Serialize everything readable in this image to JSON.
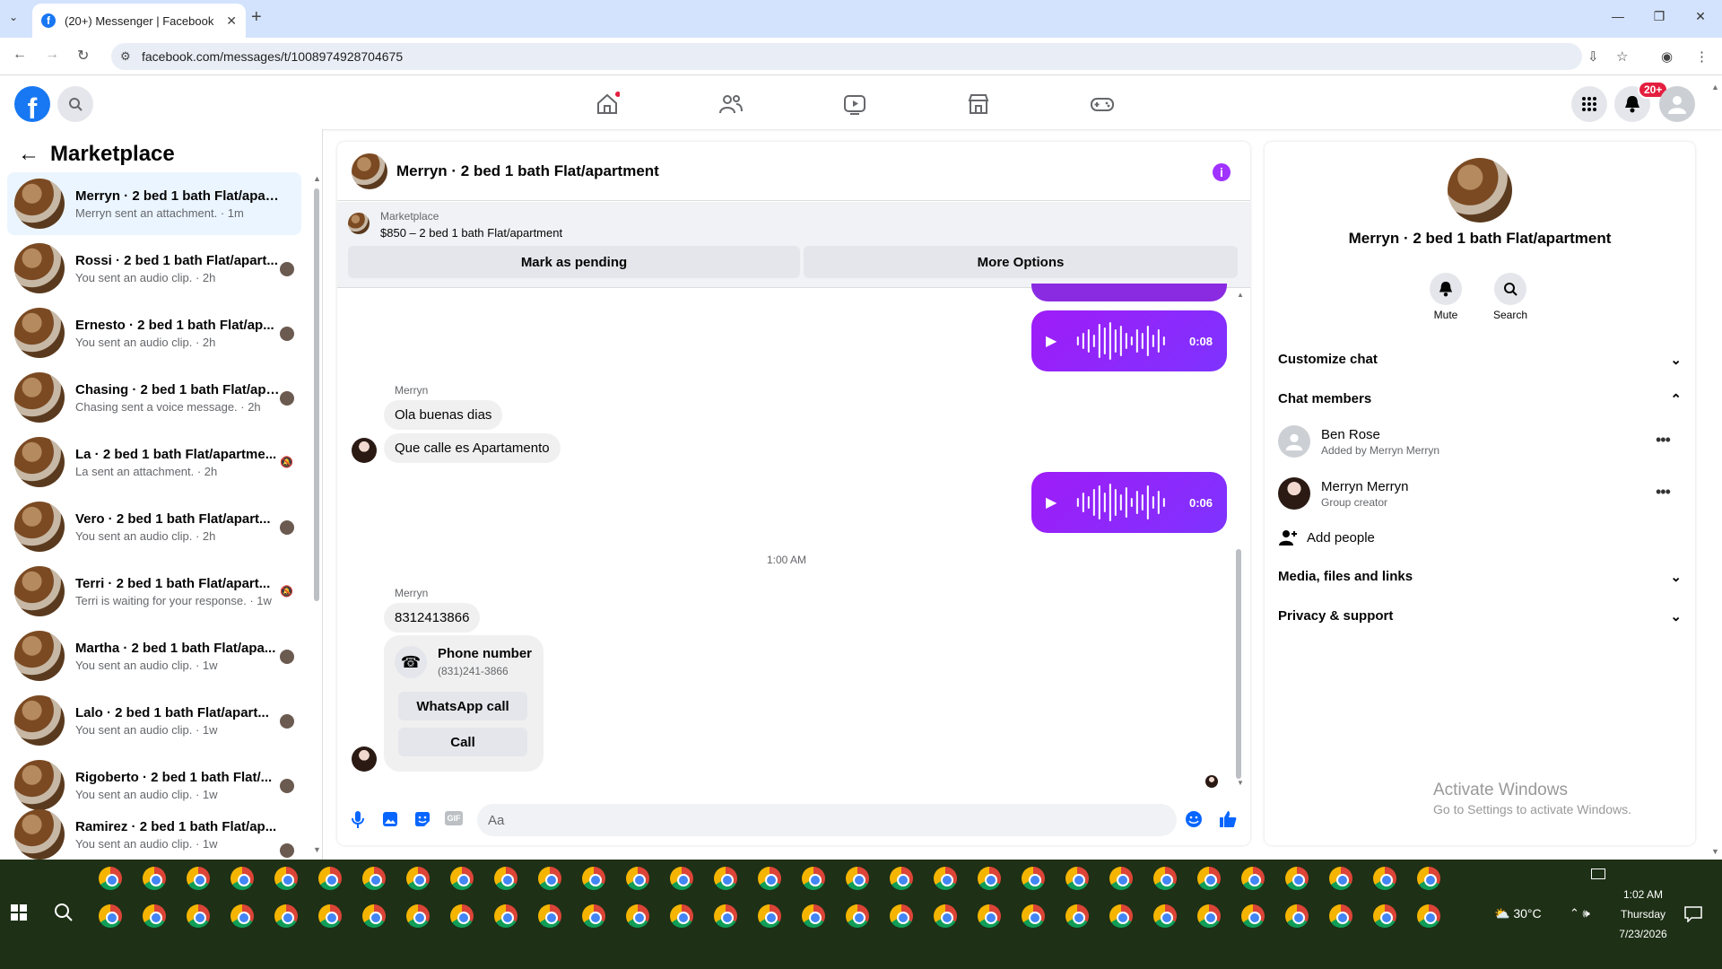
{
  "browser": {
    "tab_title": "(20+) Messenger | Facebook",
    "url": "facebook.com/messages/t/1008974928704675"
  },
  "header": {
    "notification_badge": "20+"
  },
  "sidebar": {
    "title": "Marketplace",
    "conversations": [
      {
        "name": "Merryn · 2 bed 1 bath Flat/apart...",
        "sub": "Merryn sent an attachment. · 1m",
        "active": true
      },
      {
        "name": "Rossi · 2 bed 1 bath Flat/apart...",
        "sub": "You sent an audio clip. · 2h"
      },
      {
        "name": "Ernesto · 2 bed 1 bath Flat/ap...",
        "sub": "You sent an audio clip. · 2h"
      },
      {
        "name": "Chasing · 2 bed 1 bath Flat/apart...",
        "sub": "Chasing sent a voice message. · 2h"
      },
      {
        "name": "La · 2 bed 1 bath Flat/apartme...",
        "sub": "La sent an attachment. · 2h"
      },
      {
        "name": "Vero · 2 bed 1 bath Flat/apart...",
        "sub": "You sent an audio clip. · 2h"
      },
      {
        "name": "Terri · 2 bed 1 bath Flat/apart...",
        "sub": "Terri is waiting for your response. · 1w"
      },
      {
        "name": "Martha · 2 bed 1 bath Flat/apa...",
        "sub": "You sent an audio clip. · 1w"
      },
      {
        "name": "Lalo · 2 bed 1 bath Flat/apart...",
        "sub": "You sent an audio clip. · 1w"
      },
      {
        "name": "Rigoberto · 2 bed 1 bath Flat/...",
        "sub": "You sent an audio clip. · 1w"
      },
      {
        "name": "Ramirez · 2 bed 1 bath Flat/ap...",
        "sub": "You sent an audio clip. · 1w"
      }
    ]
  },
  "chat": {
    "title": "Merryn · 2 bed 1 bath Flat/apartment",
    "marketplace_label": "Marketplace",
    "listing": "$850 – 2 bed 1 bath Flat/apartment",
    "mark_pending": "Mark as pending",
    "more_options": "More Options",
    "audio1_duration": "0:08",
    "audio2_duration": "0:06",
    "sender_name": "Merryn",
    "msg1": "Ola buenas  dias",
    "msg2": "Que calle es Apartamento",
    "timestamp": "1:00 AM",
    "msg3": "8312413866",
    "phone_card_title": "Phone number",
    "phone_card_number": "(831)241-3866",
    "whatsapp_call": "WhatsApp call",
    "call": "Call",
    "composer_placeholder": "Aa"
  },
  "details": {
    "title": "Merryn · 2 bed 1 bath Flat/apartment",
    "mute": "Mute",
    "search": "Search",
    "customize_chat": "Customize chat",
    "chat_members": "Chat members",
    "members": [
      {
        "name": "Ben Rose",
        "sub": "Added by Merryn Merryn"
      },
      {
        "name": "Merryn Merryn",
        "sub": "Group creator"
      }
    ],
    "add_people": "Add people",
    "media_files": "Media, files and links",
    "privacy": "Privacy & support",
    "activate_title": "Activate Windows",
    "activate_sub": "Go to Settings to activate Windows."
  },
  "taskbar": {
    "time": "1:02 AM",
    "day": "Thursday",
    "date": "7/23/2026",
    "temperature": "30°C"
  },
  "colors": {
    "fb_blue": "#1877f2",
    "audio_purple": "#8a2be2",
    "active_row": "#ebf5ff"
  }
}
